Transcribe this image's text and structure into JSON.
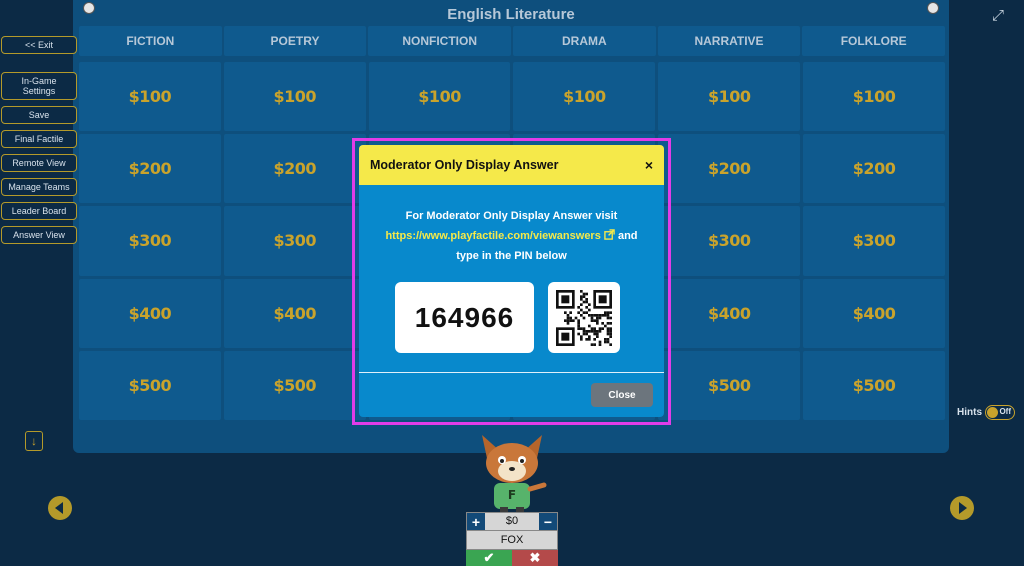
{
  "board": {
    "title": "English Literature",
    "categories": [
      "FICTION",
      "POETRY",
      "NONFICTION",
      "DRAMA",
      "NARRATIVE",
      "FOLKLORE"
    ],
    "values": [
      "$100",
      "$200",
      "$300",
      "$400",
      "$500"
    ]
  },
  "menu": {
    "exit": "<< Exit",
    "ingame_settings": "In-Game Settings",
    "save": "Save",
    "final_factile": "Final Factile",
    "remote_view": "Remote View",
    "manage_teams": "Manage Teams",
    "leader_board": "Leader Board",
    "answer_view": "Answer View"
  },
  "hints": {
    "label": "Hints",
    "state": "Off"
  },
  "team": {
    "name": "FOX",
    "score": "$0",
    "avatar_letter": "F"
  },
  "modal": {
    "title": "Moderator Only Display Answer",
    "close_x": "×",
    "line1": "For Moderator Only Display Answer visit",
    "link": "https://www.playfactile.com/viewanswers",
    "line2_suffix": "and",
    "line3": "type in the PIN below",
    "pin": "164966",
    "close_label": "Close"
  },
  "icons": {
    "expand": "expand-icon",
    "external_link": "external-link-icon",
    "qr": "qr-code-icon"
  },
  "colors": {
    "board": "#0e4f7d",
    "cell": "#0f5a8e",
    "gold": "#c9a32c",
    "modal_header": "#f5e94a",
    "modal_body": "#0889cc",
    "highlight": "#e23ce8"
  }
}
